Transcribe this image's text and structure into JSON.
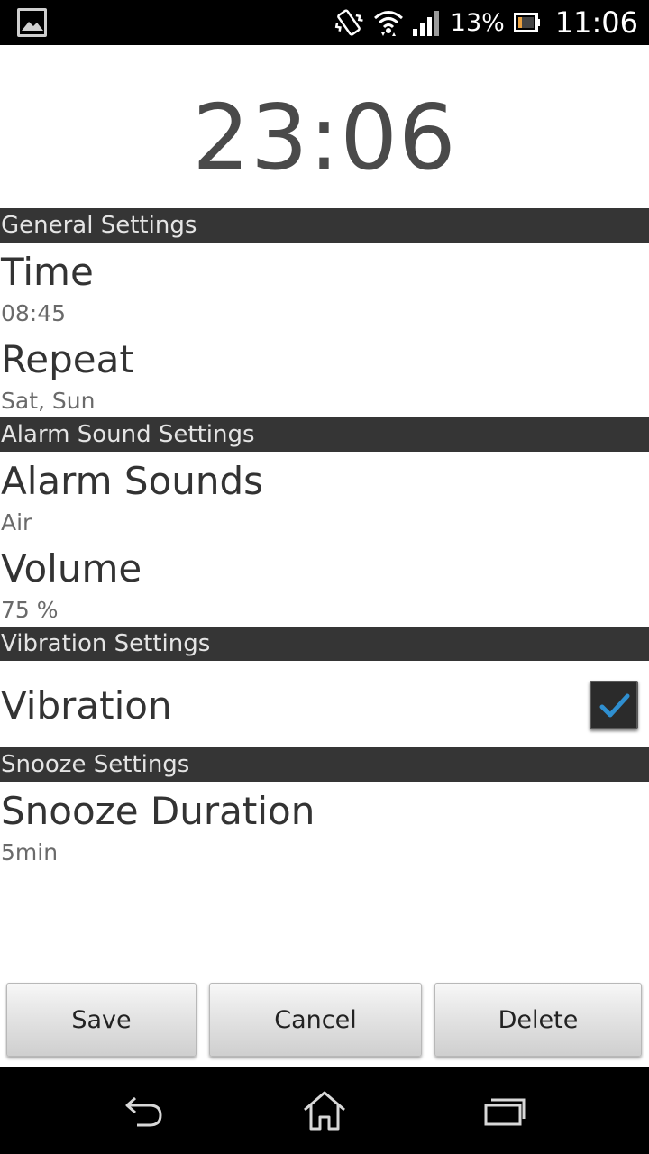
{
  "status_bar": {
    "battery_percent": "13%",
    "time": "11:06",
    "icons": [
      "gallery-icon",
      "vibrate-icon",
      "wifi-icon",
      "signal-icon",
      "battery-icon"
    ]
  },
  "clock": {
    "time": "23:06"
  },
  "sections": {
    "general": {
      "header": "General Settings",
      "time_title": "Time",
      "time_value": "08:45",
      "repeat_title": "Repeat",
      "repeat_value": "Sat, Sun"
    },
    "alarm_sound": {
      "header": "Alarm Sound Settings",
      "sounds_title": "Alarm Sounds",
      "sounds_value": "Air",
      "volume_title": "Volume",
      "volume_value": "75 %"
    },
    "vibration": {
      "header": "Vibration Settings",
      "vibration_title": "Vibration",
      "vibration_checked": true
    },
    "snooze": {
      "header": "Snooze Settings",
      "duration_title": "Snooze Duration",
      "duration_value": "5min"
    }
  },
  "buttons": {
    "save": "Save",
    "cancel": "Cancel",
    "delete": "Delete"
  },
  "nav": {
    "icons": [
      "back-icon",
      "home-icon",
      "recent-apps-icon"
    ]
  },
  "colors": {
    "section_header_bg": "#353535",
    "checkmark": "#2f8fd0"
  }
}
